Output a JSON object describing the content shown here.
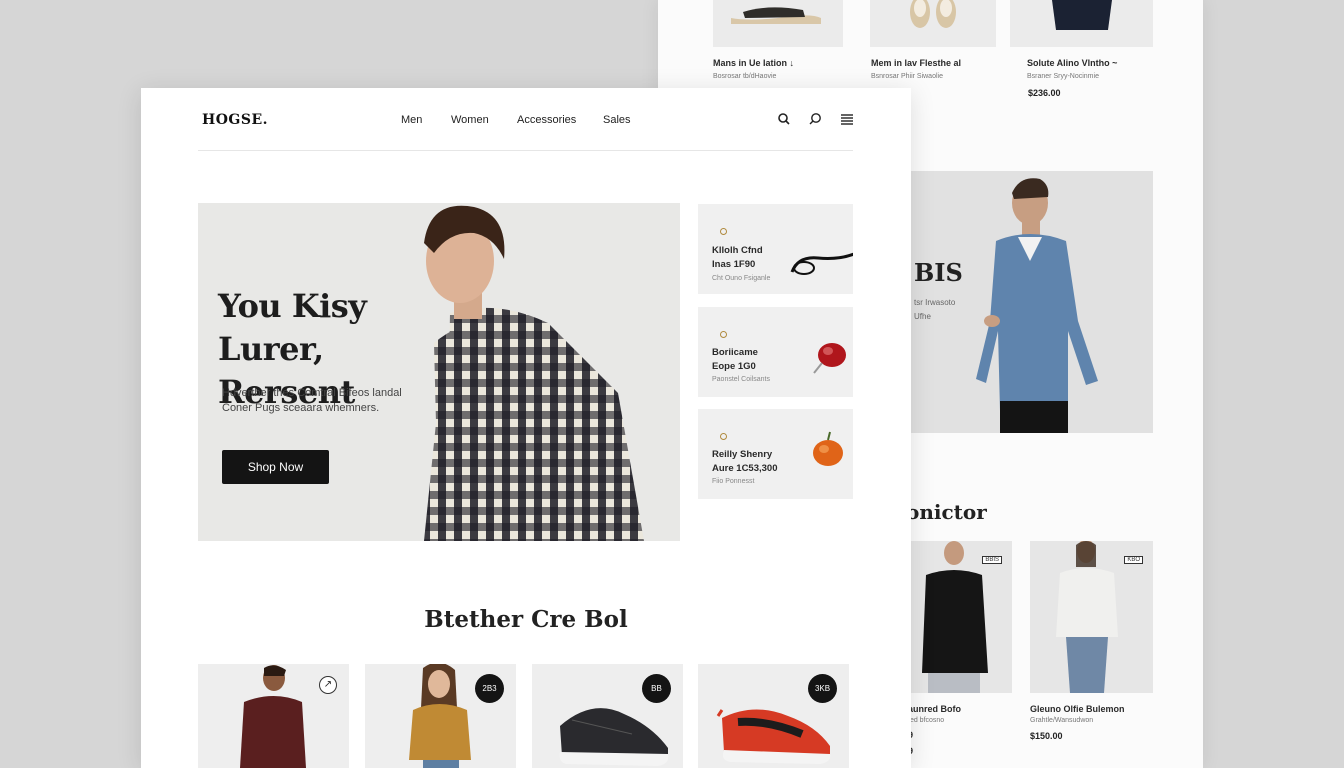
{
  "back_page": {
    "top_products": [
      {
        "name": "Mans in Ue Iation ↓",
        "sub": "Bosrosar tb/dHaovie",
        "price": ""
      },
      {
        "name": "Mem in lav Flesthe al",
        "sub": "Bsnrosar Phiir Siwaolie",
        "price": ""
      },
      {
        "name": "Solute Alino Vlntho ~",
        "sub": "Bsraner Sryy-Nocinmie",
        "price": "$236.00"
      }
    ],
    "hero": {
      "title": "BIS",
      "line1": "tsr Irwasoto",
      "line2": "Ufhe"
    },
    "section_title": "onictor",
    "cards": [
      {
        "badge": "BBIS",
        "name": "aunred Bofo",
        "sub": "fed bfcosno",
        "price": "9"
      },
      {
        "badge": "KBO",
        "name": "Gleuno Olfie Bulemon",
        "sub": "Grahtle/Wansudwon",
        "price": "$150.00"
      }
    ],
    "card1_extra_price": "9"
  },
  "header": {
    "logo": "HOGSE.",
    "nav": [
      "Men",
      "Women",
      "Accessories",
      "Sales"
    ],
    "icons": [
      "search-icon",
      "chat-search-icon",
      "menu-icon"
    ]
  },
  "hero": {
    "title": "You Kisy Lurer, Rersent",
    "description_line1": "Hdverther thes Comtral Bifeos landal",
    "description_line2": "Coner Pugs sceaara whemners.",
    "cta": "Shop Now"
  },
  "side_cards": [
    {
      "line1": "Kllolh Cfnd",
      "line2": "Inas 1F90",
      "line3": "Cht Ouno Fsiganle"
    },
    {
      "line1": "Boriicame",
      "line2": "Eope 1G0",
      "line3": "Paonstel Coilsants"
    },
    {
      "line1": "Reilly Shenry",
      "line2": "Aure 1C53,300",
      "line3": "Fiio Ponnesst"
    }
  ],
  "section_title": "Btether Cre Bol",
  "products": [
    {
      "badge": "↗"
    },
    {
      "badge": "2B3"
    },
    {
      "badge": "BB"
    },
    {
      "badge": "3KB"
    }
  ],
  "colors": {
    "accent_dark": "#141414",
    "hero_bg": "#e8e8e6",
    "page_bg": "#d6d6d6"
  }
}
